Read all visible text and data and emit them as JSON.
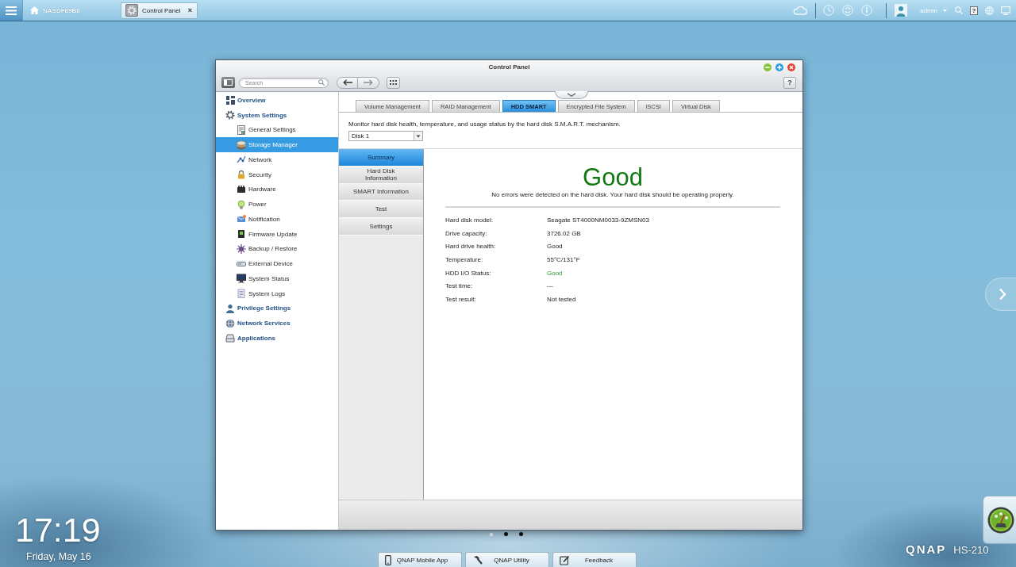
{
  "taskbar": {
    "host": "NASDF89B8",
    "tabs": [
      {
        "label": "Control Panel",
        "selected": true,
        "close": "×"
      }
    ],
    "user": "admin",
    "help": "?"
  },
  "window": {
    "title": "Control Panel",
    "search": {
      "placeholder": "Search"
    },
    "help": "?",
    "sidebar": [
      {
        "label": "Overview",
        "selected": false
      },
      {
        "label": "System Settings",
        "selected": false,
        "children": [
          {
            "label": "General Settings",
            "selected": false
          },
          {
            "label": "Storage Manager",
            "selected": true
          },
          {
            "label": "Network",
            "selected": false
          },
          {
            "label": "Security",
            "selected": false
          },
          {
            "label": "Hardware",
            "selected": false
          },
          {
            "label": "Power",
            "selected": false
          },
          {
            "label": "Notification",
            "selected": false
          },
          {
            "label": "Firmware Update",
            "selected": false
          },
          {
            "label": "Backup / Restore",
            "selected": false
          },
          {
            "label": "External Device",
            "selected": false
          },
          {
            "label": "System Status",
            "selected": false
          },
          {
            "label": "System Logs",
            "selected": false
          }
        ]
      },
      {
        "label": "Privilege Settings",
        "selected": false
      },
      {
        "label": "Network Services",
        "selected": false
      },
      {
        "label": "Applications",
        "selected": false
      }
    ],
    "tabs": [
      {
        "label": "Volume Management",
        "selected": false
      },
      {
        "label": "RAID Management",
        "selected": false
      },
      {
        "label": "HDD SMART",
        "selected": true
      },
      {
        "label": "Encrypted File System",
        "selected": false
      },
      {
        "label": "iSCSI",
        "selected": false
      },
      {
        "label": "Virtual Disk",
        "selected": false
      }
    ],
    "description": "Monitor hard disk health, temperature, and usage status by the hard disk S.M.A.R.T. mechanism.",
    "disk_select": {
      "value": "Disk 1"
    },
    "subnav": [
      {
        "label": "Summary",
        "selected": true
      },
      {
        "label": "Hard Disk Information",
        "selected": false
      },
      {
        "label": "SMART Information",
        "selected": false
      },
      {
        "label": "Test",
        "selected": false
      },
      {
        "label": "Settings",
        "selected": false
      }
    ],
    "summary": {
      "status": "Good",
      "message": "No errors were detected on the hard disk. Your hard disk should be operating properly.",
      "details": [
        {
          "label": "Hard disk model:",
          "value": "Seagate ST4000NM0033-9ZMSN03",
          "kind": "plain"
        },
        {
          "label": "Drive capacity:",
          "value": "3726.02 GB",
          "kind": "plain"
        },
        {
          "label": "Hard drive health:",
          "value": "Good",
          "kind": "plain"
        },
        {
          "label": "Temperature:",
          "value": "55°C/131°F",
          "kind": "plain"
        },
        {
          "label": "HDD I/O Status:",
          "value": "Good",
          "kind": "good"
        },
        {
          "label": "Test time:",
          "value": "---",
          "kind": "plain"
        },
        {
          "label": "Test result:",
          "value": "Not tested",
          "kind": "plain"
        }
      ]
    }
  },
  "desktop": {
    "time": "17:19",
    "date": "Friday, May 16",
    "page_dots": [
      {
        "selected": true
      },
      {
        "selected": false
      },
      {
        "selected": false
      }
    ],
    "dock": [
      {
        "label": "QNAP Mobile App"
      },
      {
        "label": "QNAP Utility"
      },
      {
        "label": "Feedback"
      }
    ],
    "brand": "QNAP",
    "model": "HS-210"
  }
}
